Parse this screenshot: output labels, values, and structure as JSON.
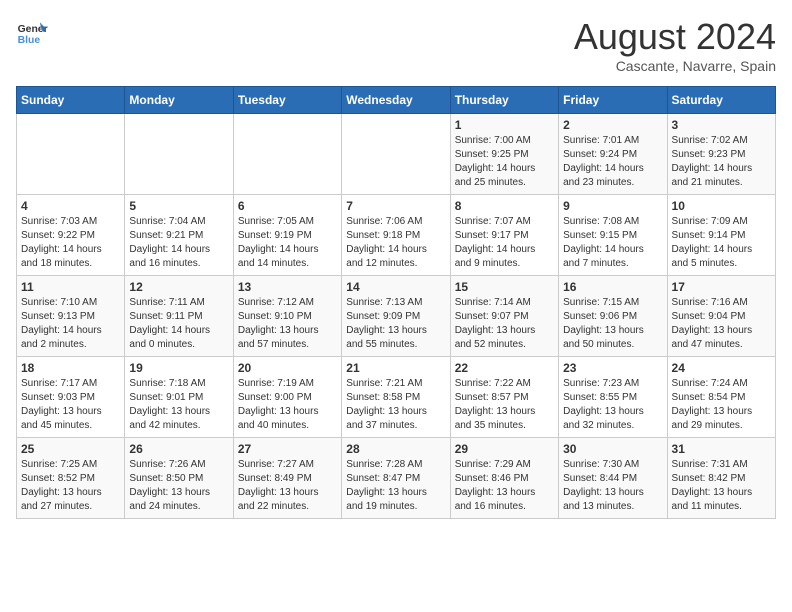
{
  "header": {
    "logo_line1": "General",
    "logo_line2": "Blue",
    "month": "August 2024",
    "location": "Cascante, Navarre, Spain"
  },
  "weekdays": [
    "Sunday",
    "Monday",
    "Tuesday",
    "Wednesday",
    "Thursday",
    "Friday",
    "Saturday"
  ],
  "weeks": [
    [
      {
        "day": "",
        "info": ""
      },
      {
        "day": "",
        "info": ""
      },
      {
        "day": "",
        "info": ""
      },
      {
        "day": "",
        "info": ""
      },
      {
        "day": "1",
        "info": "Sunrise: 7:00 AM\nSunset: 9:25 PM\nDaylight: 14 hours\nand 25 minutes."
      },
      {
        "day": "2",
        "info": "Sunrise: 7:01 AM\nSunset: 9:24 PM\nDaylight: 14 hours\nand 23 minutes."
      },
      {
        "day": "3",
        "info": "Sunrise: 7:02 AM\nSunset: 9:23 PM\nDaylight: 14 hours\nand 21 minutes."
      }
    ],
    [
      {
        "day": "4",
        "info": "Sunrise: 7:03 AM\nSunset: 9:22 PM\nDaylight: 14 hours\nand 18 minutes."
      },
      {
        "day": "5",
        "info": "Sunrise: 7:04 AM\nSunset: 9:21 PM\nDaylight: 14 hours\nand 16 minutes."
      },
      {
        "day": "6",
        "info": "Sunrise: 7:05 AM\nSunset: 9:19 PM\nDaylight: 14 hours\nand 14 minutes."
      },
      {
        "day": "7",
        "info": "Sunrise: 7:06 AM\nSunset: 9:18 PM\nDaylight: 14 hours\nand 12 minutes."
      },
      {
        "day": "8",
        "info": "Sunrise: 7:07 AM\nSunset: 9:17 PM\nDaylight: 14 hours\nand 9 minutes."
      },
      {
        "day": "9",
        "info": "Sunrise: 7:08 AM\nSunset: 9:15 PM\nDaylight: 14 hours\nand 7 minutes."
      },
      {
        "day": "10",
        "info": "Sunrise: 7:09 AM\nSunset: 9:14 PM\nDaylight: 14 hours\nand 5 minutes."
      }
    ],
    [
      {
        "day": "11",
        "info": "Sunrise: 7:10 AM\nSunset: 9:13 PM\nDaylight: 14 hours\nand 2 minutes."
      },
      {
        "day": "12",
        "info": "Sunrise: 7:11 AM\nSunset: 9:11 PM\nDaylight: 14 hours\nand 0 minutes."
      },
      {
        "day": "13",
        "info": "Sunrise: 7:12 AM\nSunset: 9:10 PM\nDaylight: 13 hours\nand 57 minutes."
      },
      {
        "day": "14",
        "info": "Sunrise: 7:13 AM\nSunset: 9:09 PM\nDaylight: 13 hours\nand 55 minutes."
      },
      {
        "day": "15",
        "info": "Sunrise: 7:14 AM\nSunset: 9:07 PM\nDaylight: 13 hours\nand 52 minutes."
      },
      {
        "day": "16",
        "info": "Sunrise: 7:15 AM\nSunset: 9:06 PM\nDaylight: 13 hours\nand 50 minutes."
      },
      {
        "day": "17",
        "info": "Sunrise: 7:16 AM\nSunset: 9:04 PM\nDaylight: 13 hours\nand 47 minutes."
      }
    ],
    [
      {
        "day": "18",
        "info": "Sunrise: 7:17 AM\nSunset: 9:03 PM\nDaylight: 13 hours\nand 45 minutes."
      },
      {
        "day": "19",
        "info": "Sunrise: 7:18 AM\nSunset: 9:01 PM\nDaylight: 13 hours\nand 42 minutes."
      },
      {
        "day": "20",
        "info": "Sunrise: 7:19 AM\nSunset: 9:00 PM\nDaylight: 13 hours\nand 40 minutes."
      },
      {
        "day": "21",
        "info": "Sunrise: 7:21 AM\nSunset: 8:58 PM\nDaylight: 13 hours\nand 37 minutes."
      },
      {
        "day": "22",
        "info": "Sunrise: 7:22 AM\nSunset: 8:57 PM\nDaylight: 13 hours\nand 35 minutes."
      },
      {
        "day": "23",
        "info": "Sunrise: 7:23 AM\nSunset: 8:55 PM\nDaylight: 13 hours\nand 32 minutes."
      },
      {
        "day": "24",
        "info": "Sunrise: 7:24 AM\nSunset: 8:54 PM\nDaylight: 13 hours\nand 29 minutes."
      }
    ],
    [
      {
        "day": "25",
        "info": "Sunrise: 7:25 AM\nSunset: 8:52 PM\nDaylight: 13 hours\nand 27 minutes."
      },
      {
        "day": "26",
        "info": "Sunrise: 7:26 AM\nSunset: 8:50 PM\nDaylight: 13 hours\nand 24 minutes."
      },
      {
        "day": "27",
        "info": "Sunrise: 7:27 AM\nSunset: 8:49 PM\nDaylight: 13 hours\nand 22 minutes."
      },
      {
        "day": "28",
        "info": "Sunrise: 7:28 AM\nSunset: 8:47 PM\nDaylight: 13 hours\nand 19 minutes."
      },
      {
        "day": "29",
        "info": "Sunrise: 7:29 AM\nSunset: 8:46 PM\nDaylight: 13 hours\nand 16 minutes."
      },
      {
        "day": "30",
        "info": "Sunrise: 7:30 AM\nSunset: 8:44 PM\nDaylight: 13 hours\nand 13 minutes."
      },
      {
        "day": "31",
        "info": "Sunrise: 7:31 AM\nSunset: 8:42 PM\nDaylight: 13 hours\nand 11 minutes."
      }
    ]
  ]
}
